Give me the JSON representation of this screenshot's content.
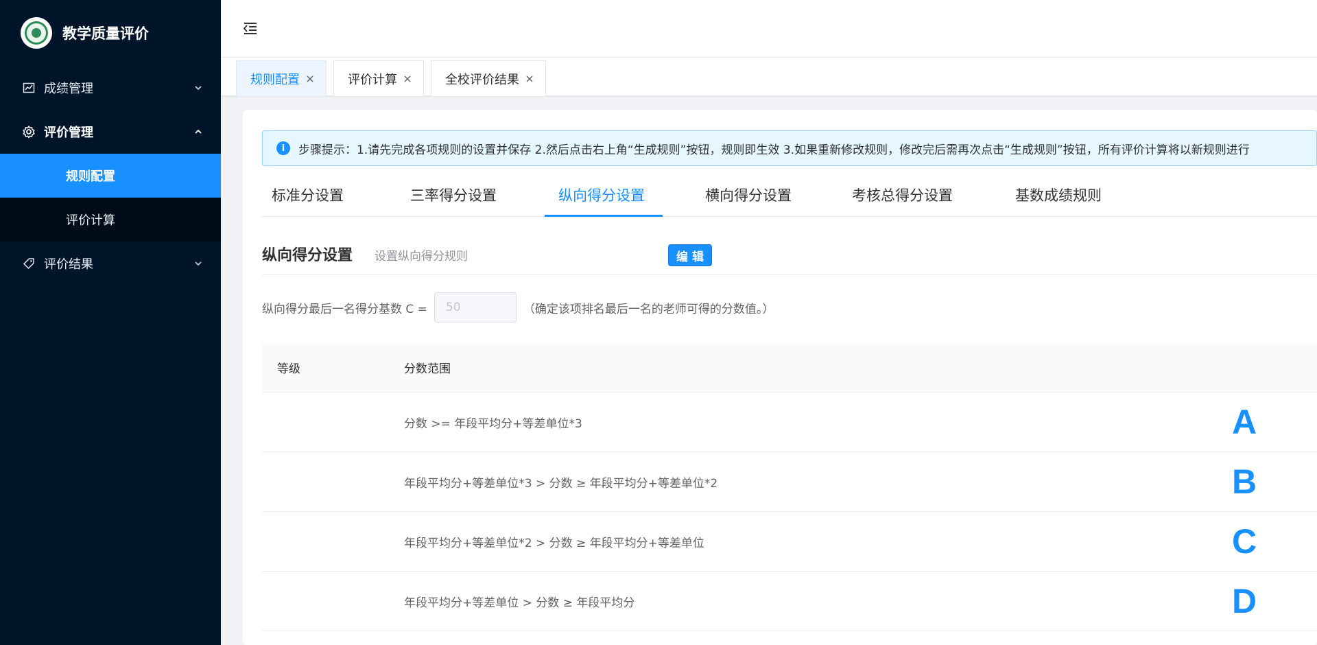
{
  "brand": {
    "title": "教学质量评价"
  },
  "sidebar": {
    "items": [
      {
        "label": "成绩管理",
        "icon": "chart-line-icon"
      },
      {
        "label": "评价管理",
        "icon": "gear-icon",
        "open": true,
        "children": [
          {
            "label": "规则配置",
            "active": true
          },
          {
            "label": "评价计算"
          }
        ]
      },
      {
        "label": "评价结果",
        "icon": "tag-icon"
      }
    ]
  },
  "tags": [
    {
      "label": "规则配置",
      "active": true
    },
    {
      "label": "评价计算"
    },
    {
      "label": "全校评价结果"
    }
  ],
  "alert": {
    "text": "步骤提示：1.请先完成各项规则的设置并保存 2.然后点击右上角“生成规则”按钮，规则即生效 3.如果重新修改规则，修改完后需再次点击“生成规则”按钮，所有评价计算将以新规则进行"
  },
  "tabs": [
    {
      "label": "标准分设置"
    },
    {
      "label": "三率得分设置"
    },
    {
      "label": "纵向得分设置",
      "active": true
    },
    {
      "label": "横向得分设置"
    },
    {
      "label": "考核总得分设置"
    },
    {
      "label": "基数成绩规则"
    }
  ],
  "section": {
    "title": "纵向得分设置",
    "subtitle": "设置纵向得分规则",
    "edit_label": "编 辑"
  },
  "base": {
    "label": "纵向得分最后一名得分基数 C =",
    "value": "50",
    "hint": "（确定该项排名最后一名的老师可得的分数值。）"
  },
  "table": {
    "headers": [
      "等级",
      "分数范围"
    ],
    "rows": [
      {
        "level": "",
        "range": "分数 >= 年段平均分+等差单位*3",
        "grade": "A"
      },
      {
        "level": "",
        "range": "年段平均分+等差单位*3 > 分数 ≥ 年段平均分+等差单位*2",
        "grade": "B"
      },
      {
        "level": "",
        "range": "年段平均分+等差单位*2 > 分数 ≥ 年段平均分+等差单位",
        "grade": "C"
      },
      {
        "level": "",
        "range": "年段平均分+等差单位 > 分数 ≥ 年段平均分",
        "grade": "D"
      }
    ]
  },
  "colors": {
    "sidebar_bg": "#001529",
    "accent": "#1890ff",
    "submenu_bg": "#000c17"
  }
}
